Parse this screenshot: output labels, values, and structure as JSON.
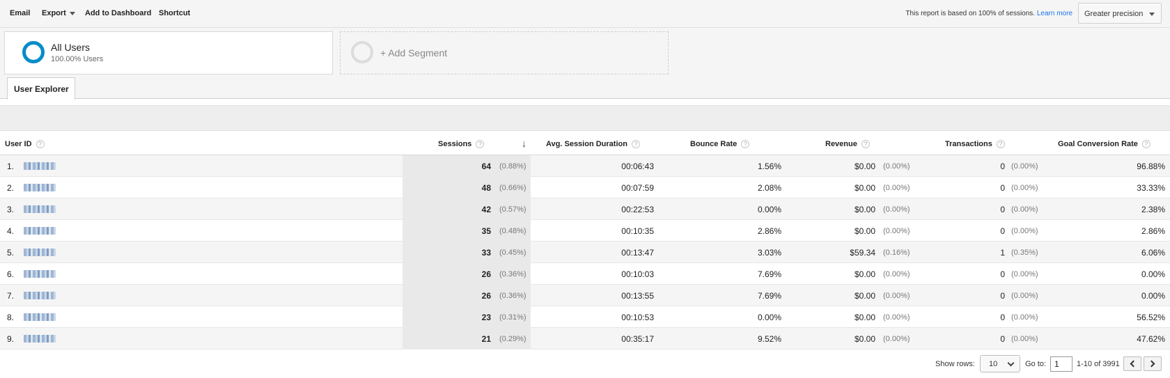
{
  "toolbar": {
    "email": "Email",
    "export": "Export",
    "add_to_dashboard": "Add to Dashboard",
    "shortcut": "Shortcut",
    "sampling_note": "This report is based on 100% of sessions.",
    "learn_more": "Learn more",
    "precision": "Greater precision"
  },
  "segments": {
    "active": {
      "title": "All Users",
      "subtitle": "100.00% Users",
      "color": "#058dc7"
    },
    "add_label": "+ Add Segment"
  },
  "tab": "User Explorer",
  "table": {
    "headers": {
      "user_id": "User ID",
      "sessions": "Sessions",
      "avg_session_duration": "Avg. Session Duration",
      "bounce_rate": "Bounce Rate",
      "revenue": "Revenue",
      "transactions": "Transactions",
      "goal_conversion_rate": "Goal Conversion Rate",
      "help": "?"
    },
    "rows": [
      {
        "idx": "1.",
        "sessions": "64",
        "sessions_pct": "(0.88%)",
        "duration": "00:06:43",
        "bounce": "1.56%",
        "revenue": "$0.00",
        "revenue_pct": "(0.00%)",
        "transactions": "0",
        "transactions_pct": "(0.00%)",
        "goal": "96.88%"
      },
      {
        "idx": "2.",
        "sessions": "48",
        "sessions_pct": "(0.66%)",
        "duration": "00:07:59",
        "bounce": "2.08%",
        "revenue": "$0.00",
        "revenue_pct": "(0.00%)",
        "transactions": "0",
        "transactions_pct": "(0.00%)",
        "goal": "33.33%"
      },
      {
        "idx": "3.",
        "sessions": "42",
        "sessions_pct": "(0.57%)",
        "duration": "00:22:53",
        "bounce": "0.00%",
        "revenue": "$0.00",
        "revenue_pct": "(0.00%)",
        "transactions": "0",
        "transactions_pct": "(0.00%)",
        "goal": "2.38%"
      },
      {
        "idx": "4.",
        "sessions": "35",
        "sessions_pct": "(0.48%)",
        "duration": "00:10:35",
        "bounce": "2.86%",
        "revenue": "$0.00",
        "revenue_pct": "(0.00%)",
        "transactions": "0",
        "transactions_pct": "(0.00%)",
        "goal": "2.86%"
      },
      {
        "idx": "5.",
        "sessions": "33",
        "sessions_pct": "(0.45%)",
        "duration": "00:13:47",
        "bounce": "3.03%",
        "revenue": "$59.34",
        "revenue_pct": "(0.16%)",
        "transactions": "1",
        "transactions_pct": "(0.35%)",
        "goal": "6.06%"
      },
      {
        "idx": "6.",
        "sessions": "26",
        "sessions_pct": "(0.36%)",
        "duration": "00:10:03",
        "bounce": "7.69%",
        "revenue": "$0.00",
        "revenue_pct": "(0.00%)",
        "transactions": "0",
        "transactions_pct": "(0.00%)",
        "goal": "0.00%"
      },
      {
        "idx": "7.",
        "sessions": "26",
        "sessions_pct": "(0.36%)",
        "duration": "00:13:55",
        "bounce": "7.69%",
        "revenue": "$0.00",
        "revenue_pct": "(0.00%)",
        "transactions": "0",
        "transactions_pct": "(0.00%)",
        "goal": "0.00%"
      },
      {
        "idx": "8.",
        "sessions": "23",
        "sessions_pct": "(0.31%)",
        "duration": "00:10:53",
        "bounce": "0.00%",
        "revenue": "$0.00",
        "revenue_pct": "(0.00%)",
        "transactions": "0",
        "transactions_pct": "(0.00%)",
        "goal": "56.52%"
      },
      {
        "idx": "9.",
        "sessions": "21",
        "sessions_pct": "(0.29%)",
        "duration": "00:35:17",
        "bounce": "9.52%",
        "revenue": "$0.00",
        "revenue_pct": "(0.00%)",
        "transactions": "0",
        "transactions_pct": "(0.00%)",
        "goal": "47.62%"
      }
    ]
  },
  "footer": {
    "show_rows_label": "Show rows:",
    "show_rows_value": "10",
    "goto_label": "Go to:",
    "goto_value": "1",
    "range": "1-10 of 3991"
  }
}
